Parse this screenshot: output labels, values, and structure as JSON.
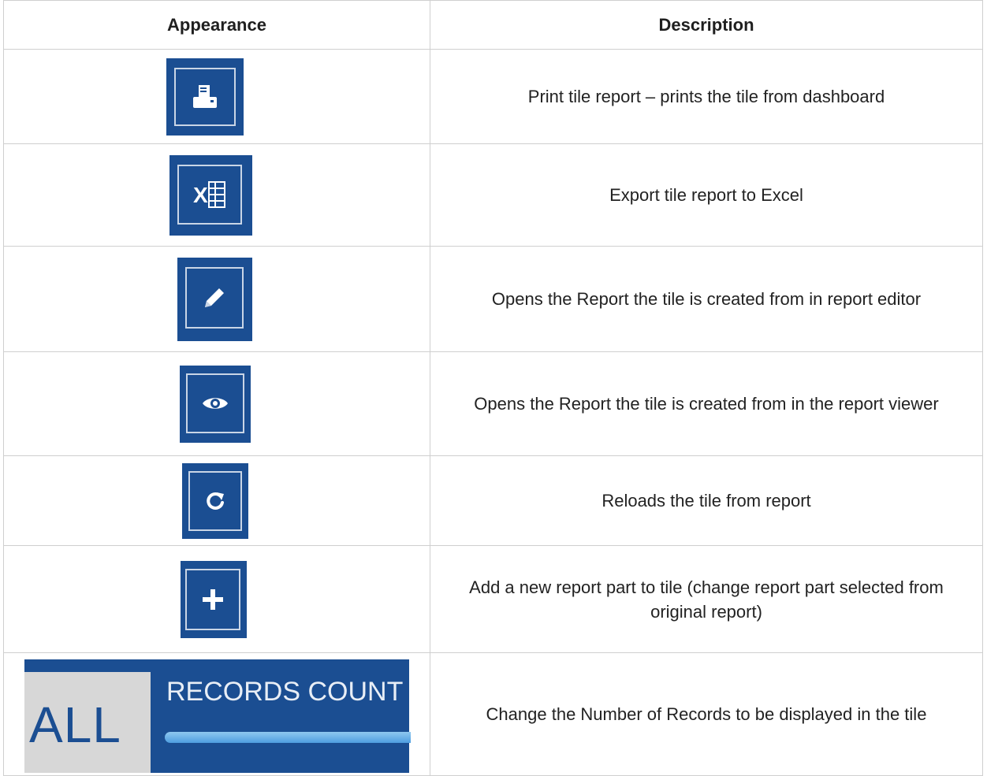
{
  "header": {
    "appearance": "Appearance",
    "description": "Description"
  },
  "rows": [
    {
      "icon": "print-icon",
      "description": "Print tile report – prints the tile from dashboard"
    },
    {
      "icon": "excel-icon",
      "description": "Export tile report to Excel"
    },
    {
      "icon": "pencil-icon",
      "description": "Opens the Report the tile is created from in report editor"
    },
    {
      "icon": "eye-icon",
      "description": "Opens the Report the tile is created from in the report viewer"
    },
    {
      "icon": "reload-icon",
      "description": "Reloads the tile from report"
    },
    {
      "icon": "plus-icon",
      "description": "Add a new report part to tile (change report part selected from original report)"
    },
    {
      "icon": "records-count-control",
      "description": "Change the Number of Records to be displayed in the tile",
      "control": {
        "value": "ALL",
        "label": "RECORDS COUNT"
      }
    }
  ],
  "colors": {
    "tile_bg": "#1b4e92",
    "tile_border": "#c9d5e6",
    "bar": "#4e9de0"
  }
}
